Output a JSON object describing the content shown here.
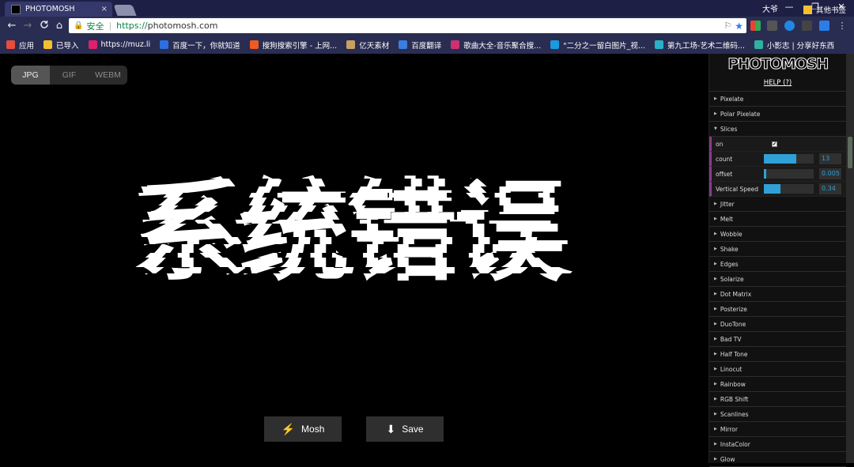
{
  "tab": {
    "title": "PHOTOMOSH",
    "close": "×"
  },
  "window": {
    "user": "大爷",
    "minimize": "—",
    "restore": "❐",
    "close": "✕"
  },
  "nav": {
    "back": "←",
    "forward": "→",
    "reload": "C",
    "home": "⌂"
  },
  "omnibox": {
    "secure_label": "安全",
    "separator": "|",
    "url_scheme": "https://",
    "url_host": "photomosh.com"
  },
  "bookmarks": [
    {
      "label": "应用",
      "color": "#e84c3d"
    },
    {
      "label": "已导入",
      "color": "#f5c030"
    },
    {
      "label": "https://muz.li",
      "color": "#e0206a"
    },
    {
      "label": "百度一下，你就知道",
      "color": "#2d6fe0"
    },
    {
      "label": "搜狗搜索引擎 - 上网...",
      "color": "#f05a22"
    },
    {
      "label": "亿天素材",
      "color": "#c8a060"
    },
    {
      "label": "百度翻译",
      "color": "#3a7ee0"
    },
    {
      "label": "歌曲大全-音乐聚合搜...",
      "color": "#d03070"
    },
    {
      "label": "\"二分之一留白图片_视...",
      "color": "#1a9ae0"
    },
    {
      "label": "第九工场-艺术二维码...",
      "color": "#2ab0c8"
    },
    {
      "label": "小影志 | 分享好东西",
      "color": "#30b0a0"
    }
  ],
  "bookmarks_other": "其他书签",
  "formats": [
    "JPG",
    "GIF",
    "WEBM"
  ],
  "active_format": "JPG",
  "canvas_text": "系统错误",
  "actions": {
    "mosh": "Mosh",
    "save": "Save"
  },
  "panel": {
    "logo": "PHOTOMOSH",
    "help": "HELP (?)",
    "effects_before": [
      "Pixelate",
      "Polar Pixelate",
      "Slices"
    ],
    "slices": {
      "on_label": "on",
      "on": true,
      "count_label": "count",
      "count": "13",
      "count_fraction": 0.65,
      "offset_label": "offset",
      "offset": "0.005",
      "offset_fraction": 0.04,
      "speed_label": "Vertical Speed",
      "speed": "0.34",
      "speed_fraction": 0.34
    },
    "effects_after": [
      "Jitter",
      "Melt",
      "Wobble",
      "Shake",
      "Edges",
      "Solarize",
      "Dot Matrix",
      "Posterize",
      "DuoTone",
      "Bad TV",
      "Half Tone",
      "Linocut",
      "Rainbow",
      "RGB Shift",
      "Scanlines",
      "Mirror",
      "InstaColor",
      "Glow"
    ]
  },
  "colors": {
    "accent": "#2fa1d6",
    "folder_marker": "#8b3a8b"
  }
}
